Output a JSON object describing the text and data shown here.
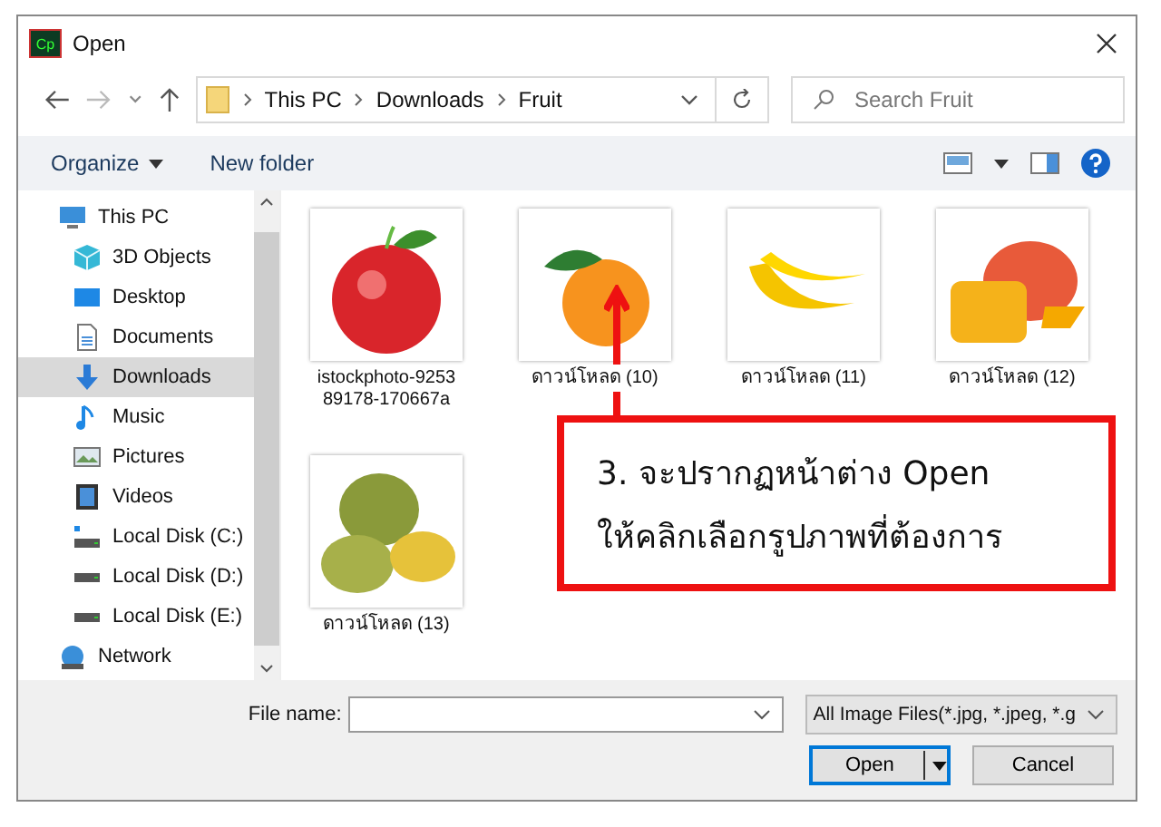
{
  "window": {
    "title": "Open",
    "app_icon": "Cp"
  },
  "address": {
    "path": [
      "This PC",
      "Downloads",
      "Fruit"
    ]
  },
  "search": {
    "placeholder": "Search Fruit"
  },
  "toolbar": {
    "organize": "Organize",
    "new_folder": "New folder"
  },
  "sidebar": {
    "items": [
      {
        "label": "This PC",
        "selected": false,
        "children": [
          {
            "label": "3D Objects",
            "selected": false
          },
          {
            "label": "Desktop",
            "selected": false
          },
          {
            "label": "Documents",
            "selected": false
          },
          {
            "label": "Downloads",
            "selected": true
          },
          {
            "label": "Music",
            "selected": false
          },
          {
            "label": "Pictures",
            "selected": false
          },
          {
            "label": "Videos",
            "selected": false
          },
          {
            "label": "Local Disk (C:)",
            "selected": false
          },
          {
            "label": "Local Disk (D:)",
            "selected": false
          },
          {
            "label": "Local Disk (E:)",
            "selected": false
          }
        ]
      },
      {
        "label": "Network",
        "selected": false
      }
    ]
  },
  "files": [
    {
      "name_lines": [
        "istockphoto-9253",
        "89178-170667a"
      ]
    },
    {
      "name_lines": [
        "ดาวน์โหลด (10)"
      ]
    },
    {
      "name_lines": [
        "ดาวน์โหลด (11)"
      ]
    },
    {
      "name_lines": [
        "ดาวน์โหลด (12)"
      ]
    },
    {
      "name_lines": [
        "ดาวน์โหลด (13)"
      ]
    }
  ],
  "footer": {
    "file_name_label": "File name:",
    "file_type": "All Image Files(*.jpg, *.jpeg, *.g",
    "buttons": [
      "Open",
      "Cancel"
    ]
  },
  "callout": {
    "lines": [
      "3.  จะปรากฏหน้าต่าง Open",
      "ให้คลิกเลือกรูปภาพที่ต้องการ"
    ]
  }
}
